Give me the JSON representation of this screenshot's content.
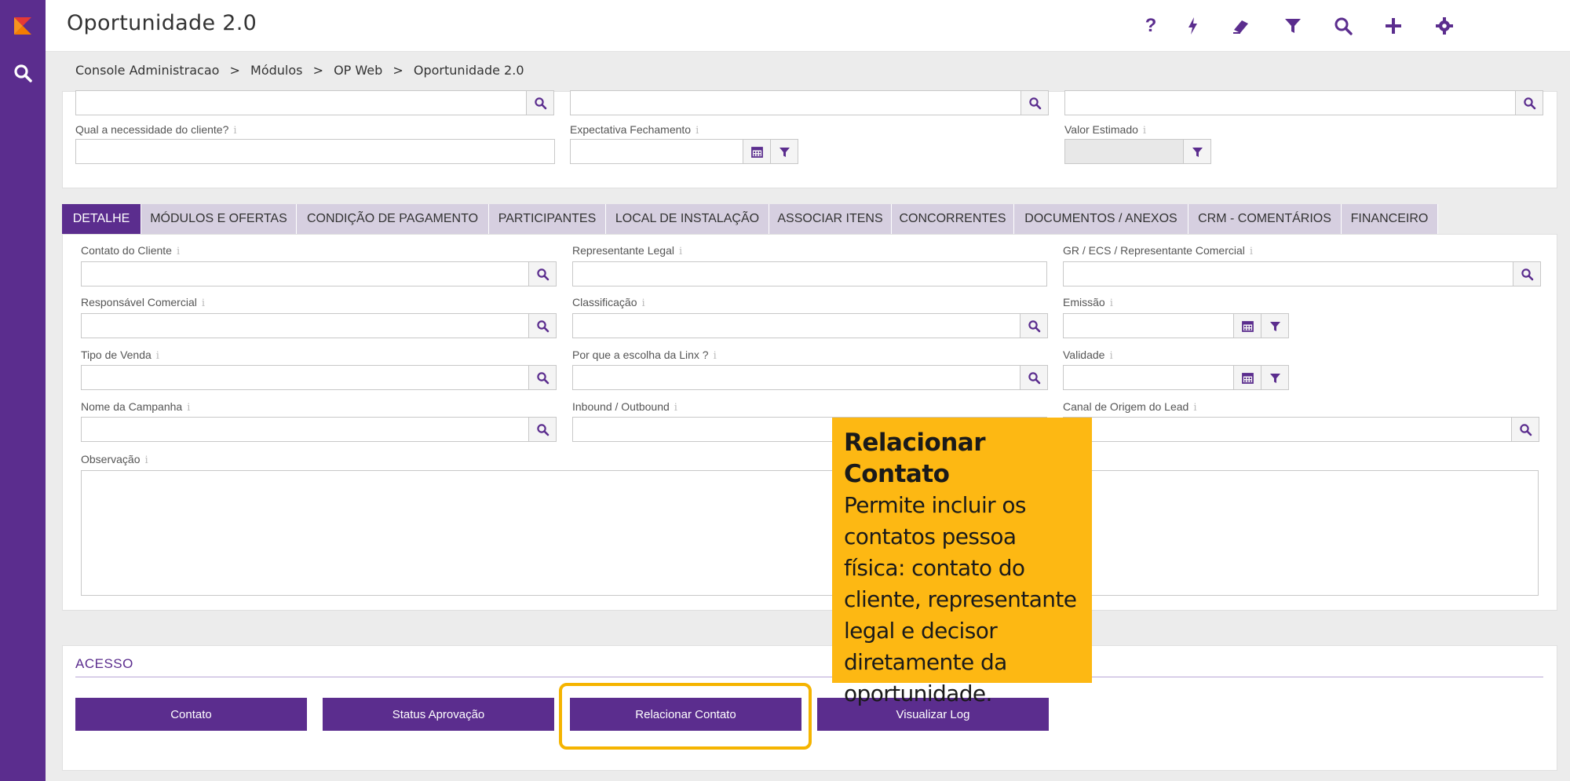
{
  "app": {
    "title": "Oportunidade 2.0"
  },
  "breadcrumb": [
    "Console Administracao",
    ">",
    "Módulos",
    ">",
    "OP Web",
    ">",
    "Oportunidade 2.0"
  ],
  "colors": {
    "primary": "#5b2d8e",
    "tab_inactive": "#d6cfe0",
    "callout": "#fdb813",
    "highlight": "#f5b400"
  },
  "top_form": {
    "necessidade_label": "Qual a necessidade do cliente?",
    "expectativa_label": "Expectativa Fechamento",
    "valor_label": "Valor Estimado"
  },
  "tabs": [
    "DETALHE",
    "MÓDULOS E OFERTAS",
    "CONDIÇÃO DE PAGAMENTO",
    "PARTICIPANTES",
    "LOCAL DE INSTALAÇÃO",
    "ASSOCIAR ITENS",
    "CONCORRENTES",
    "DOCUMENTOS / ANEXOS",
    "CRM - COMENTÁRIOS",
    "FINANCEIRO"
  ],
  "detail": {
    "contato_cliente": "Contato do Cliente",
    "representante_legal": "Representante Legal",
    "gr_ecs": "GR / ECS / Representante Comercial",
    "responsavel_comercial": "Responsável Comercial",
    "classificacao": "Classificação",
    "emissao": "Emissão",
    "tipo_venda": "Tipo de Venda",
    "por_que_linx": "Por que a escolha da Linx ?",
    "validade": "Validade",
    "nome_campanha": "Nome da Campanha",
    "inbound_outbound": "Inbound / Outbound",
    "canal_origem": "Canal de Origem do Lead",
    "observacao": "Observação"
  },
  "acesso": {
    "title": "ACESSO",
    "buttons": [
      "Contato",
      "Status Aprovação",
      "Relacionar Contato",
      "Visualizar Log"
    ]
  },
  "callout": {
    "title": "Relacionar Contato",
    "body": "Permite incluir os contatos pessoa física: contato do cliente, representante legal e decisor diretamente da oportunidade."
  }
}
